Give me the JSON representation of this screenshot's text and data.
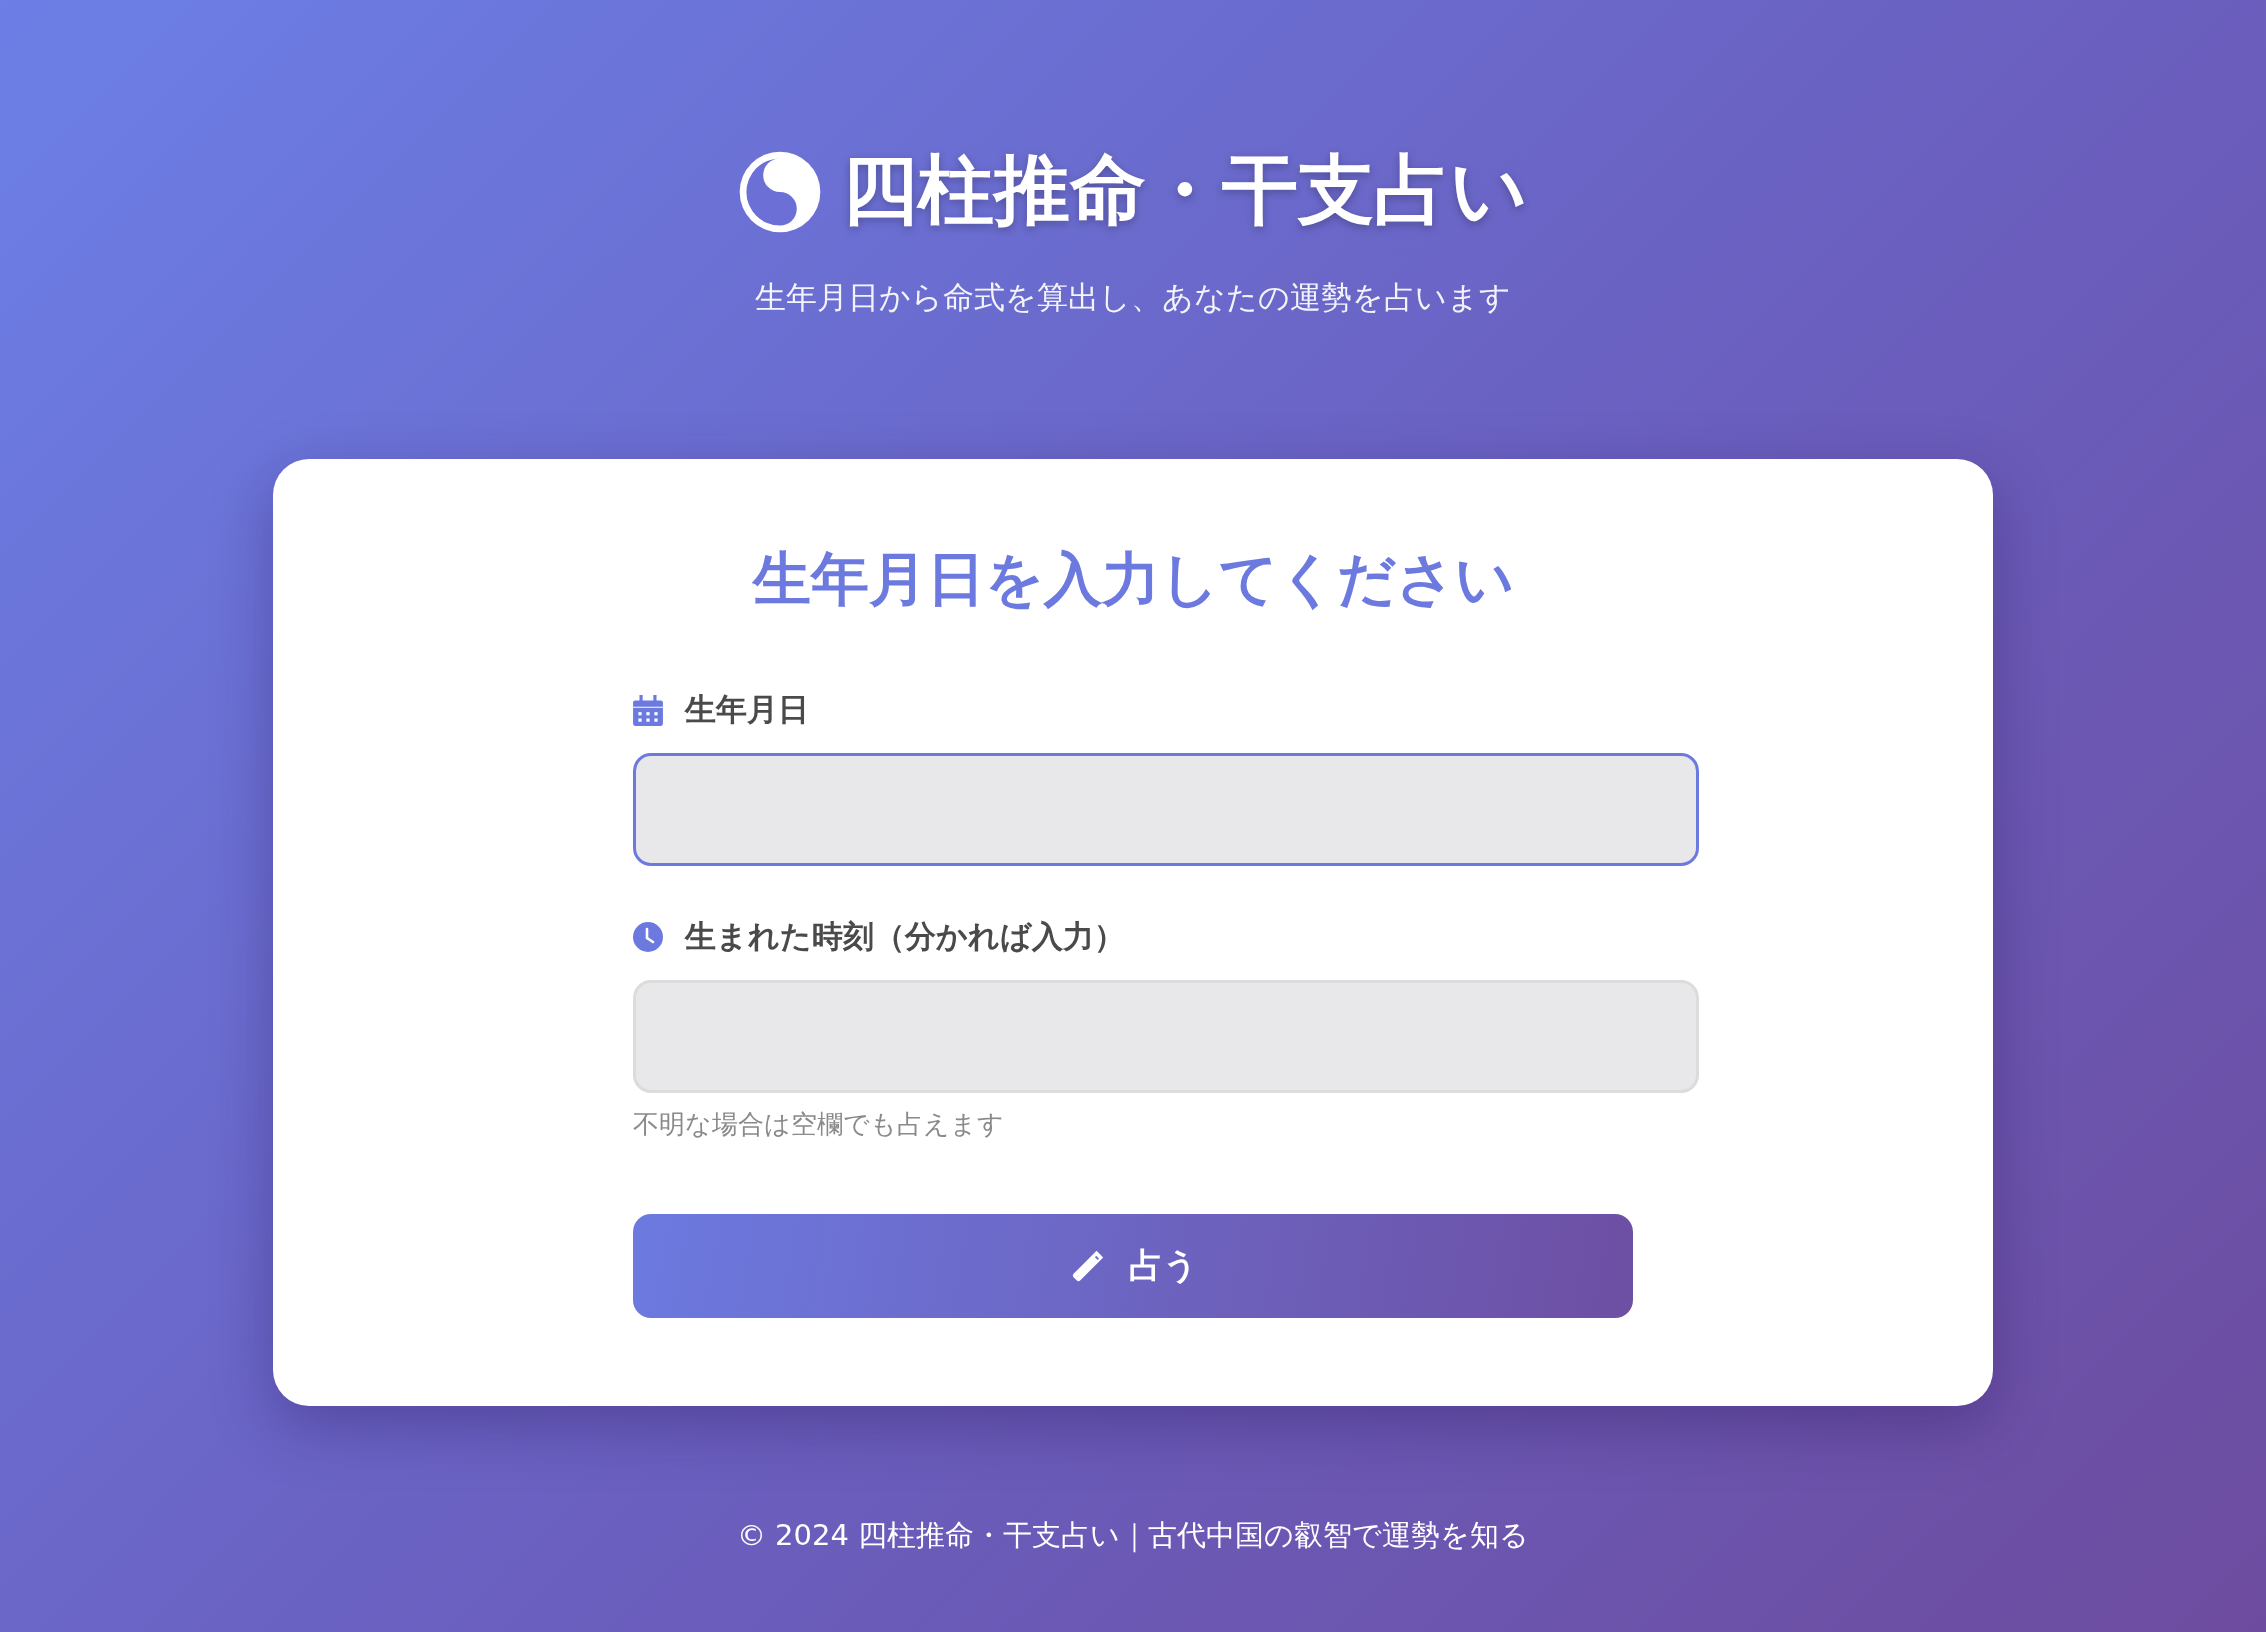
{
  "header": {
    "title": "四柱推命・干支占い",
    "subtitle": "生年月日から命式を算出し、あなたの運勢を占います"
  },
  "form": {
    "heading": "生年月日を入力してください",
    "fields": [
      {
        "kind": "date",
        "label": "生年月日",
        "focused": true
      },
      {
        "kind": "time",
        "label": "生まれた時刻（分かれば入力）",
        "focused": false,
        "hint": "不明な場合は空欄でも占えます"
      }
    ],
    "submit": "占う"
  },
  "footer": "© 2024 四柱推命・干支占い｜古代中国の叡智で運勢を知る"
}
